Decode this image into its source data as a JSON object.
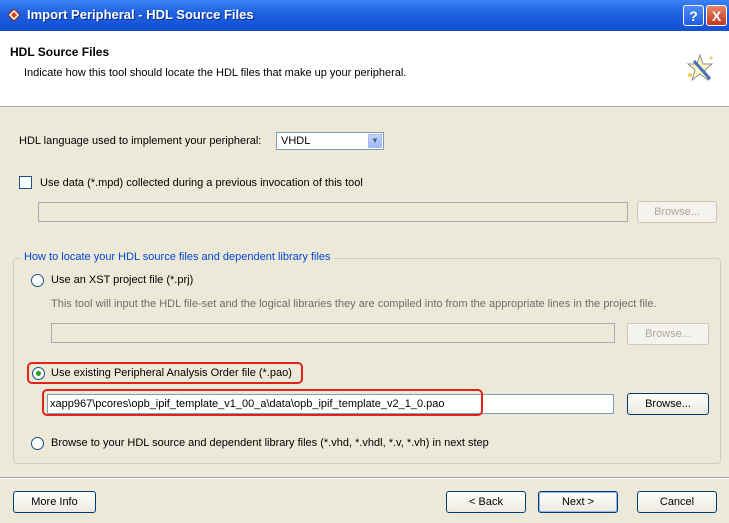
{
  "window": {
    "title": "Import Peripheral - HDL Source Files",
    "help_button": "?",
    "close_button": "X"
  },
  "header": {
    "title": "HDL Source Files",
    "description": "Indicate how this tool should locate the HDL files that make up your peripheral."
  },
  "hdl_language": {
    "label": "HDL language used to implement your peripheral:",
    "value": "VHDL"
  },
  "mpd_option": {
    "label": "Use data (*.mpd) collected during a previous invocation of this tool",
    "checked": false,
    "path": "",
    "browse_label": "Browse..."
  },
  "group": {
    "title": "How to locate your HDL source files and dependent library files",
    "options": [
      {
        "label": "Use an XST project file (*.prj)",
        "description": "This tool will input the HDL file-set and the logical libraries they are compiled into from the appropriate lines in the project file.",
        "path": "",
        "browse_label": "Browse...",
        "selected": false
      },
      {
        "label": "Use existing Peripheral Analysis Order file (*.pao)",
        "path": "xapp967\\pcores\\opb_ipif_template_v1_00_a\\data\\opb_ipif_template_v2_1_0.pao",
        "browse_label": "Browse...",
        "selected": true
      },
      {
        "label": "Browse to your HDL source and dependent library files (*.vhd, *.vhdl, *.v, *.vh) in next step",
        "selected": false
      }
    ]
  },
  "footer": {
    "more_info": "More Info",
    "back": "< Back",
    "next": "Next >",
    "cancel": "Cancel"
  },
  "colors": {
    "title_bar": "#1d5fe0",
    "highlight": "#e2231a",
    "group_title": "#0046d5"
  }
}
